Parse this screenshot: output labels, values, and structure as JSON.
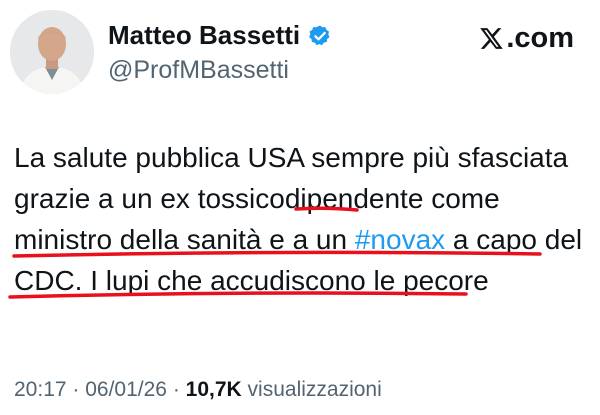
{
  "author": {
    "display_name": "Matteo Bassetti",
    "handle": "@ProfMBassetti",
    "verified": true
  },
  "brand": {
    "label": ".com",
    "icon": "x-logo-icon"
  },
  "tweet": {
    "segments": [
      "La salute pubblica USA sempre più sfasciata grazie a un ",
      "ex",
      " ",
      "tossicodipendente",
      "  come ministro della ",
      "sanità e a un ",
      "#novax",
      " a capo del CDC.",
      " I lupi che accudiscono le pecore"
    ]
  },
  "meta": {
    "time": "20:17",
    "date": "06/01/26",
    "sep": " · ",
    "views_count": "10,7K",
    "views_label": "visualizzazioni"
  },
  "colors": {
    "text": "#0f1419",
    "secondary": "#536471",
    "link": "#1d9bf0",
    "verified": "#1d9bf0",
    "annotation": "#e8101d"
  }
}
